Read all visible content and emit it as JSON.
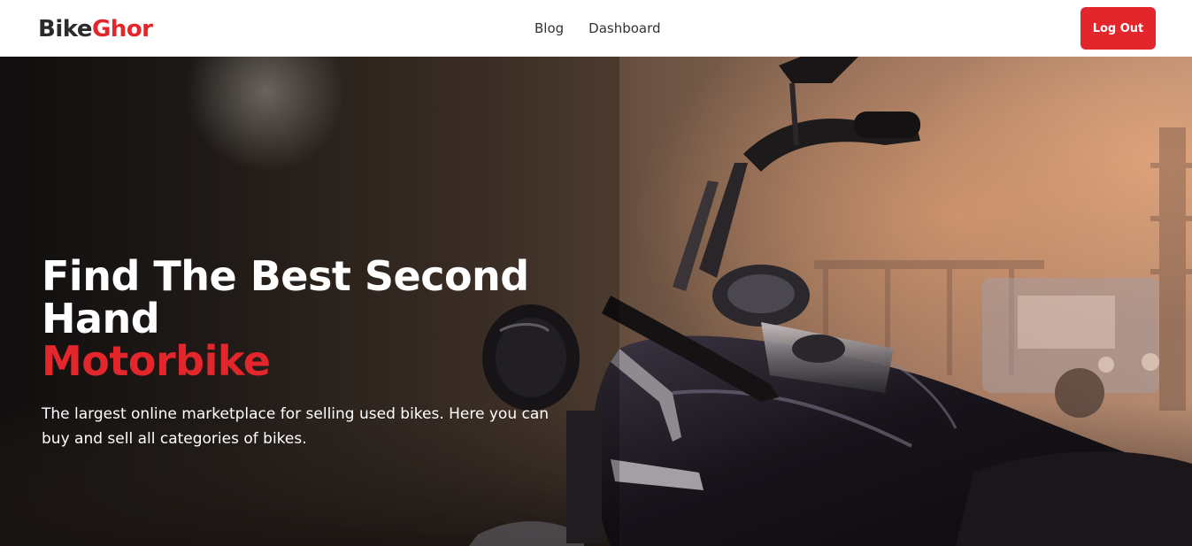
{
  "navbar": {
    "brand_part1": "Bike",
    "brand_part2": "Ghor",
    "links": [
      {
        "label": "Blog"
      },
      {
        "label": "Dashboard"
      }
    ],
    "logout_label": "Log Out"
  },
  "hero": {
    "title_line1": "Find The Best Second Hand",
    "title_line2": "Motorbike",
    "description": "The largest online marketplace for selling used bikes. Here you can buy and sell all categories of bikes.",
    "background_image": "motorcycle-photo"
  },
  "colors": {
    "accent": "#e3262b",
    "brand_dark": "#2b2b2b"
  }
}
